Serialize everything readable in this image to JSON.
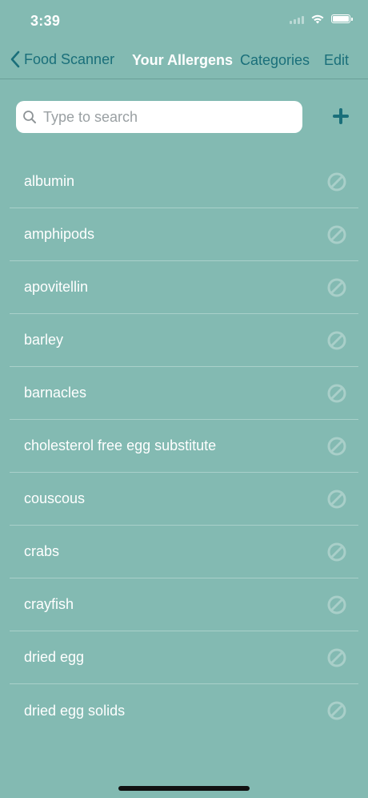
{
  "status_bar": {
    "time": "3:39",
    "icons": [
      "signal-icon",
      "wifi-icon",
      "battery-icon"
    ]
  },
  "nav": {
    "back_label": "Food Scanner",
    "title": "Your Allergens",
    "categories_label": "Categories",
    "edit_label": "Edit"
  },
  "search": {
    "placeholder": "Type to search",
    "value": ""
  },
  "add_icon": "plus-icon",
  "allergens": [
    {
      "label": "albumin",
      "icon": "block-icon"
    },
    {
      "label": "amphipods",
      "icon": "block-icon"
    },
    {
      "label": "apovitellin",
      "icon": "block-icon"
    },
    {
      "label": "barley",
      "icon": "block-icon"
    },
    {
      "label": "barnacles",
      "icon": "block-icon"
    },
    {
      "label": "cholesterol free egg substitute",
      "icon": "block-icon"
    },
    {
      "label": "couscous",
      "icon": "block-icon"
    },
    {
      "label": "crabs",
      "icon": "block-icon"
    },
    {
      "label": "crayfish",
      "icon": "block-icon"
    },
    {
      "label": "dried egg",
      "icon": "block-icon"
    },
    {
      "label": "dried egg solids",
      "icon": "block-icon"
    }
  ],
  "colors": {
    "background": "#83bab2",
    "accent": "#1a6f7a",
    "text": "#ffffff",
    "separator": "#a9d0ca",
    "disabled_icon": "#a9cfc9"
  }
}
